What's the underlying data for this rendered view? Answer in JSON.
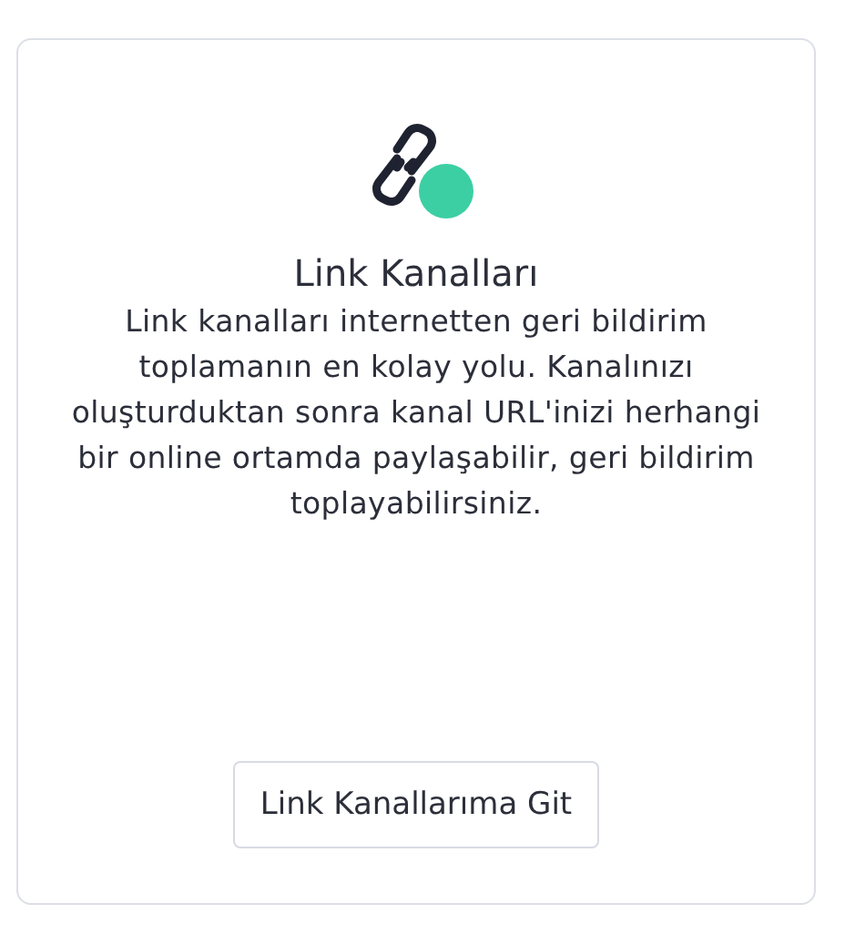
{
  "card": {
    "title": "Link Kanalları",
    "description": "Link kanalları internetten geri bildirim toplamanın en kolay yolu. Kanalınızı oluşturduktan sonra kanal URL'inizi herhangi bir online ortamda paylaşabilir, geri bildirim toplayabilirsiniz.",
    "button": "Link Kanallarıma Git"
  }
}
